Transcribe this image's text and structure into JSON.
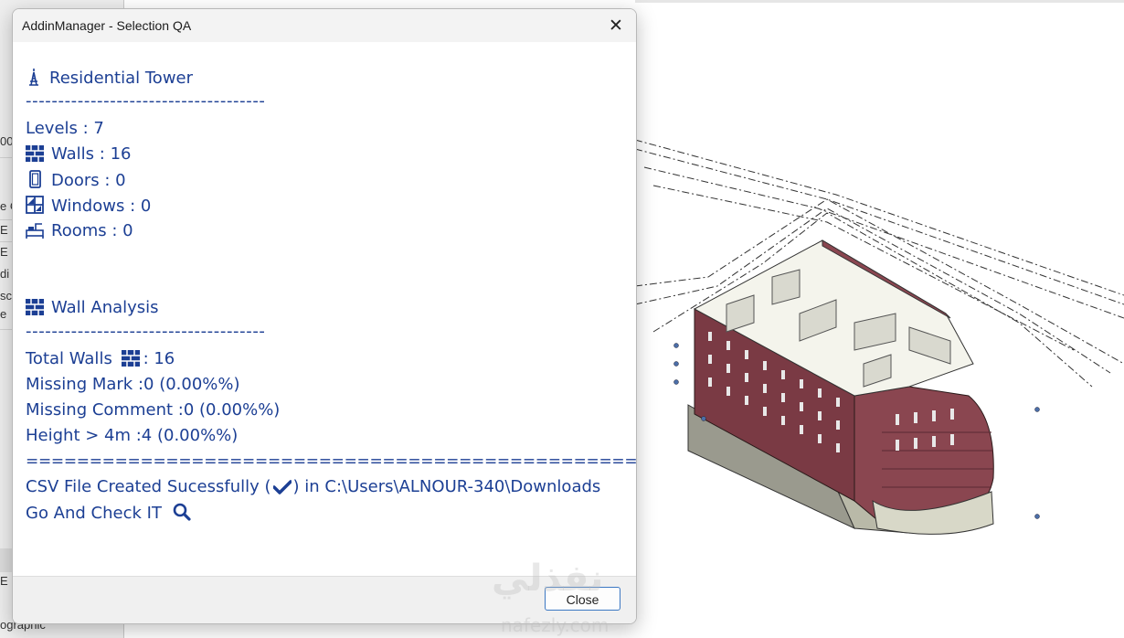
{
  "dialog": {
    "title": "AddinManager - Selection QA",
    "close_icon": "close-icon",
    "project_name": "Residential Tower",
    "separator": "-------------------------------------",
    "levels": "Levels : 7",
    "walls": "Walls : 16",
    "doors": "Doors : 0",
    "windows": "Windows : 0",
    "rooms": "Rooms : 0",
    "wall_analysis_title": "Wall Analysis",
    "total_walls_label": "Total Walls",
    "total_walls_value": ": 16",
    "missing_mark": "Missing Mark :0 (0.00%%)",
    "missing_comment": "Missing Comment :0 (0.00%%)",
    "height_over_4m": "Height > 4m :4 (0.00%%)",
    "equals_separator": "==================================================...",
    "csv_prefix": "CSV File Created Sucessfully (",
    "csv_suffix": ") in C:\\Users\\ALNOUR-340\\Downloads",
    "go_check": "Go And Check IT",
    "close_button": "Close",
    "accent_color": "#1c3f94"
  },
  "left_panel": {
    "rows": [
      "00",
      "e C",
      "E",
      "E",
      "di",
      "sc",
      "e",
      "",
      "",
      "",
      "E",
      "ographic"
    ]
  },
  "watermark": {
    "arabic": "نفذلي",
    "latin": "nafezly.com"
  }
}
